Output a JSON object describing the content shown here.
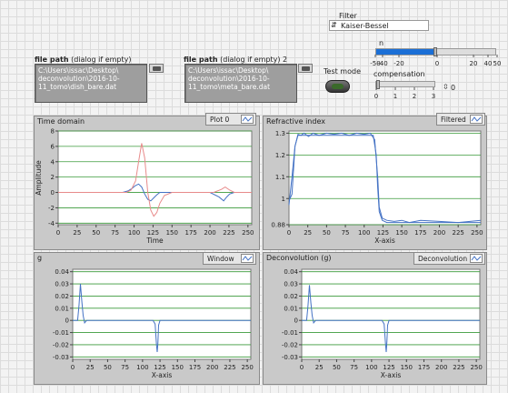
{
  "filter": {
    "label": "Filter",
    "value": "Kaiser-Bessel"
  },
  "file1": {
    "label_bold": "file path",
    "label_rest": " (dialog if empty)",
    "lines": [
      "C:\\Users\\issac\\Desktop\\",
      "deconvolution\\2016-10-",
      "11_tomo\\dish_bare.dat"
    ]
  },
  "file2": {
    "label_bold": "file path",
    "label_rest": " (dialog if empty) 2",
    "lines": [
      "C:\\Users\\issac\\Desktop\\",
      "deconvolution\\2016-10-",
      "11_tomo\\meta_bare.dat"
    ]
  },
  "test_mode": {
    "label": "Test mode"
  },
  "n_slider": {
    "label": "n",
    "ticks": [
      "-50",
      "-40",
      "-20",
      "0",
      "20",
      "40",
      "50"
    ],
    "value": 0
  },
  "compensation": {
    "label": "compensation",
    "ticks": [
      "0",
      "1",
      "2",
      "3"
    ],
    "value": 0,
    "display": "0"
  },
  "graphs": [
    {
      "title": "Time domain",
      "legend": "Plot 0",
      "xlabel": "Time",
      "ylabel": "Amplitude",
      "yticks": [
        "8",
        "6",
        "4",
        "2",
        "0",
        "-2",
        "-4"
      ],
      "xticks": [
        "0",
        "25",
        "50",
        "75",
        "100",
        "125",
        "150",
        "175",
        "200",
        "225",
        "250"
      ]
    },
    {
      "title": "Refractive index",
      "legend": "Filtered",
      "xlabel": "X-axis",
      "ylabel": "",
      "yticks": [
        "1.3",
        "1.2",
        "1.1",
        "1",
        "0.88"
      ],
      "xticks": [
        "0",
        "25",
        "50",
        "75",
        "100",
        "125",
        "150",
        "175",
        "200",
        "225",
        "250"
      ]
    },
    {
      "title": "g",
      "legend": "Window",
      "xlabel": "X-axis",
      "ylabel": "",
      "yticks": [
        "0.04",
        "0.03",
        "0.02",
        "0.01",
        "0",
        "-0.01",
        "-0.02",
        "-0.03"
      ],
      "xticks": [
        "0",
        "25",
        "50",
        "75",
        "100",
        "125",
        "150",
        "175",
        "200",
        "225",
        "250"
      ]
    },
    {
      "title": "Deconvolution (g)",
      "legend": "Deconvolution",
      "xlabel": "X-axis",
      "ylabel": "",
      "yticks": [
        "0.04",
        "0.03",
        "0.02",
        "0.01",
        "0",
        "-0.01",
        "-0.02",
        "-0.03"
      ],
      "xticks": [
        "0",
        "25",
        "50",
        "75",
        "100",
        "125",
        "150",
        "175",
        "200",
        "225",
        "250"
      ]
    }
  ],
  "chart_data": [
    {
      "type": "line",
      "title": "Time domain",
      "xlabel": "Time",
      "ylabel": "Amplitude",
      "xlim": [
        0,
        255
      ],
      "ylim": [
        -4.2,
        8
      ],
      "series": [
        {
          "color": "#4472c4",
          "x": [
            0,
            85,
            92,
            97,
            102,
            106,
            110,
            114,
            118,
            122,
            126,
            130,
            134,
            140,
            150,
            160,
            175,
            200,
            212,
            218,
            222,
            226,
            232,
            240,
            255
          ],
          "y": [
            0,
            0,
            0.2,
            0.5,
            0.9,
            1.1,
            0.7,
            -0.2,
            -0.9,
            -1.1,
            -0.7,
            -0.3,
            0,
            0,
            0,
            0,
            0,
            0,
            -0.6,
            -1.1,
            -0.6,
            -0.2,
            0,
            0,
            0
          ]
        },
        {
          "color": "#e88b8b",
          "x": [
            0,
            90,
            96,
            102,
            106,
            110,
            114,
            118,
            122,
            126,
            130,
            134,
            140,
            150,
            160,
            175,
            205,
            215,
            220,
            226,
            232,
            240,
            255
          ],
          "y": [
            0,
            0,
            0.3,
            1.5,
            4,
            6.4,
            4.5,
            0,
            -2.3,
            -3.1,
            -2.6,
            -1.4,
            -0.4,
            0,
            0,
            0,
            0,
            0.4,
            0.7,
            0.3,
            0,
            0,
            0
          ]
        }
      ]
    },
    {
      "type": "line",
      "title": "Refractive index",
      "xlabel": "X-axis",
      "xlim": [
        0,
        255
      ],
      "ylim": [
        0.88,
        1.31
      ],
      "series": [
        {
          "color": "#4472c4",
          "x": [
            0,
            4,
            8,
            12,
            16,
            20,
            26,
            32,
            40,
            50,
            60,
            70,
            80,
            90,
            100,
            108,
            114,
            118,
            120,
            124,
            130,
            140,
            150,
            160,
            175,
            200,
            225,
            255
          ],
          "y": [
            0.97,
            1.1,
            1.24,
            1.295,
            1.29,
            1.3,
            1.285,
            1.3,
            1.29,
            1.3,
            1.295,
            1.3,
            1.29,
            1.3,
            1.295,
            1.3,
            1.27,
            1.1,
            0.96,
            0.91,
            0.9,
            0.895,
            0.9,
            0.89,
            0.9,
            0.895,
            0.89,
            0.9
          ]
        },
        {
          "color": "#4472c4",
          "x": [
            0,
            4,
            8,
            12,
            20,
            40,
            60,
            80,
            100,
            112,
            116,
            118,
            120,
            124,
            130,
            150,
            175,
            200,
            225,
            255
          ],
          "y": [
            0.99,
            1.02,
            1.24,
            1.29,
            1.29,
            1.29,
            1.29,
            1.29,
            1.29,
            1.29,
            1.2,
            1.05,
            0.94,
            0.9,
            0.89,
            0.89,
            0.89,
            0.89,
            0.89,
            0.89
          ]
        }
      ]
    },
    {
      "type": "line",
      "title": "g",
      "xlabel": "X-axis",
      "xlim": [
        0,
        255
      ],
      "ylim": [
        -0.032,
        0.042
      ],
      "series": [
        {
          "color": "#4472c4",
          "x": [
            0,
            4,
            7,
            9,
            11,
            13,
            15,
            17,
            20,
            30,
            50,
            80,
            100,
            115,
            118,
            120,
            121,
            122,
            123,
            125,
            128,
            140,
            170,
            200,
            230,
            255
          ],
          "y": [
            0,
            0,
            0,
            0.012,
            0.03,
            0.016,
            0.004,
            -0.002,
            0,
            0,
            0,
            0,
            0,
            0,
            -0.003,
            -0.02,
            -0.026,
            -0.018,
            -0.004,
            0,
            0,
            0,
            0,
            0,
            0,
            0
          ]
        }
      ]
    },
    {
      "type": "line",
      "title": "Deconvolution (g)",
      "xlabel": "X-axis",
      "xlim": [
        0,
        255
      ],
      "ylim": [
        -0.032,
        0.042
      ],
      "series": [
        {
          "color": "#4472c4",
          "x": [
            0,
            4,
            7,
            9,
            11,
            13,
            15,
            17,
            20,
            30,
            50,
            80,
            100,
            115,
            118,
            120,
            121,
            122,
            123,
            125,
            128,
            140,
            170,
            200,
            230,
            255
          ],
          "y": [
            0,
            0,
            0,
            0.012,
            0.029,
            0.015,
            0.004,
            -0.002,
            0,
            0,
            0,
            0,
            0,
            0,
            -0.003,
            -0.019,
            -0.026,
            -0.017,
            -0.004,
            0,
            0,
            0,
            0,
            0,
            0,
            0
          ]
        }
      ]
    }
  ]
}
